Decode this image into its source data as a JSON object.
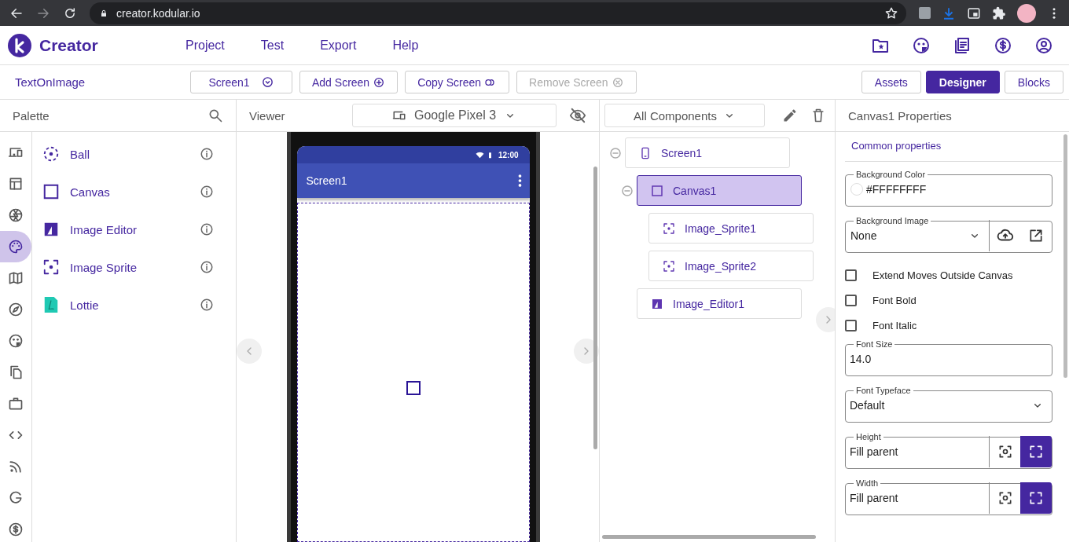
{
  "browser": {
    "url": "creator.kodular.io"
  },
  "app": {
    "name": "Creator",
    "menu": [
      "Project",
      "Test",
      "Export",
      "Help"
    ]
  },
  "toolbar": {
    "project": "TextOnImage",
    "screen_select": "Screen1",
    "buttons": [
      {
        "label": "Add Screen",
        "kind": "add",
        "disabled": false
      },
      {
        "label": "Copy Screen",
        "kind": "copy",
        "disabled": false
      },
      {
        "label": "Remove Screen",
        "kind": "remove",
        "disabled": true
      }
    ],
    "views": [
      {
        "label": "Assets",
        "selected": false
      },
      {
        "label": "Designer",
        "selected": true
      },
      {
        "label": "Blocks",
        "selected": false
      }
    ]
  },
  "palette": {
    "title": "Palette",
    "categories": [
      {
        "selected": false
      },
      {
        "selected": false
      },
      {
        "selected": false
      },
      {
        "selected": true
      },
      {
        "selected": false
      },
      {
        "selected": false
      },
      {
        "selected": false
      },
      {
        "selected": false
      },
      {
        "selected": false
      },
      {
        "selected": false
      },
      {
        "selected": false
      },
      {
        "selected": false
      },
      {
        "selected": false
      }
    ],
    "items": [
      {
        "label": "Ball",
        "kind": "ball"
      },
      {
        "label": "Canvas",
        "kind": "canvas"
      },
      {
        "label": "Image Editor",
        "kind": "image_editor"
      },
      {
        "label": "Image Sprite",
        "kind": "sprite"
      },
      {
        "label": "Lottie",
        "kind": "lottie"
      }
    ]
  },
  "viewer": {
    "title": "Viewer",
    "device": "Google Pixel 3",
    "phone": {
      "time": "12:00",
      "screen_title": "Screen1"
    }
  },
  "components": {
    "filter": "All Components",
    "tree": [
      {
        "label": "Screen1",
        "kind": "screen",
        "expanded": true,
        "selected": false,
        "children": [
          {
            "label": "Canvas1",
            "kind": "canvas",
            "expanded": true,
            "selected": true,
            "children": [
              {
                "label": "Image_Sprite1",
                "kind": "sprite",
                "selected": false
              },
              {
                "label": "Image_Sprite2",
                "kind": "sprite",
                "selected": false
              }
            ]
          },
          {
            "label": "Image_Editor1",
            "kind": "image_editor",
            "selected": false
          }
        ]
      }
    ]
  },
  "properties": {
    "title": "Canvas1 Properties",
    "section": "Common properties",
    "fields": [
      {
        "kind": "color",
        "label": "Background Color",
        "value": "#FFFFFFFF"
      },
      {
        "kind": "asset",
        "label": "Background Image",
        "value": "None"
      },
      {
        "kind": "checkbox",
        "label": "Extend Moves Outside Canvas",
        "checked": false
      },
      {
        "kind": "checkbox",
        "label": "Font Bold",
        "checked": false
      },
      {
        "kind": "checkbox",
        "label": "Font Italic",
        "checked": false
      },
      {
        "kind": "text",
        "label": "Font Size",
        "value": "14.0"
      },
      {
        "kind": "select",
        "label": "Font Typeface",
        "value": "Default"
      },
      {
        "kind": "size",
        "label": "Height",
        "value": "Fill parent",
        "options": [
          {
            "selected": false
          },
          {
            "selected": true
          }
        ]
      },
      {
        "kind": "size",
        "label": "Width",
        "value": "Fill parent",
        "options": [
          {
            "selected": false
          },
          {
            "selected": true
          }
        ]
      }
    ]
  }
}
